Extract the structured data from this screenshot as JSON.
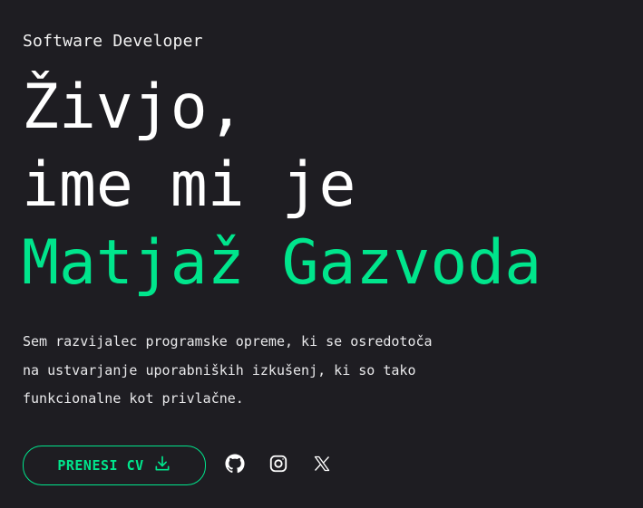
{
  "hero": {
    "role": "Software Developer",
    "headline_line1": "Živjo,",
    "headline_line2": "ime mi je",
    "name": "Matjaž Gazvoda",
    "description_lines": [
      "Sem razvijalec programske opreme, ki se osredotoča",
      "na ustvarjanje uporabniških izkušenj, ki so tako",
      "funkcionalne kot privlačne."
    ]
  },
  "actions": {
    "cv_button_label": "PRENESI CV",
    "cv_icon": "download-icon"
  },
  "social": [
    {
      "name": "github-icon"
    },
    {
      "name": "instagram-icon"
    },
    {
      "name": "x-icon"
    }
  ],
  "colors": {
    "background": "#1e1d22",
    "accent": "#00e58c",
    "text": "#ffffff"
  }
}
